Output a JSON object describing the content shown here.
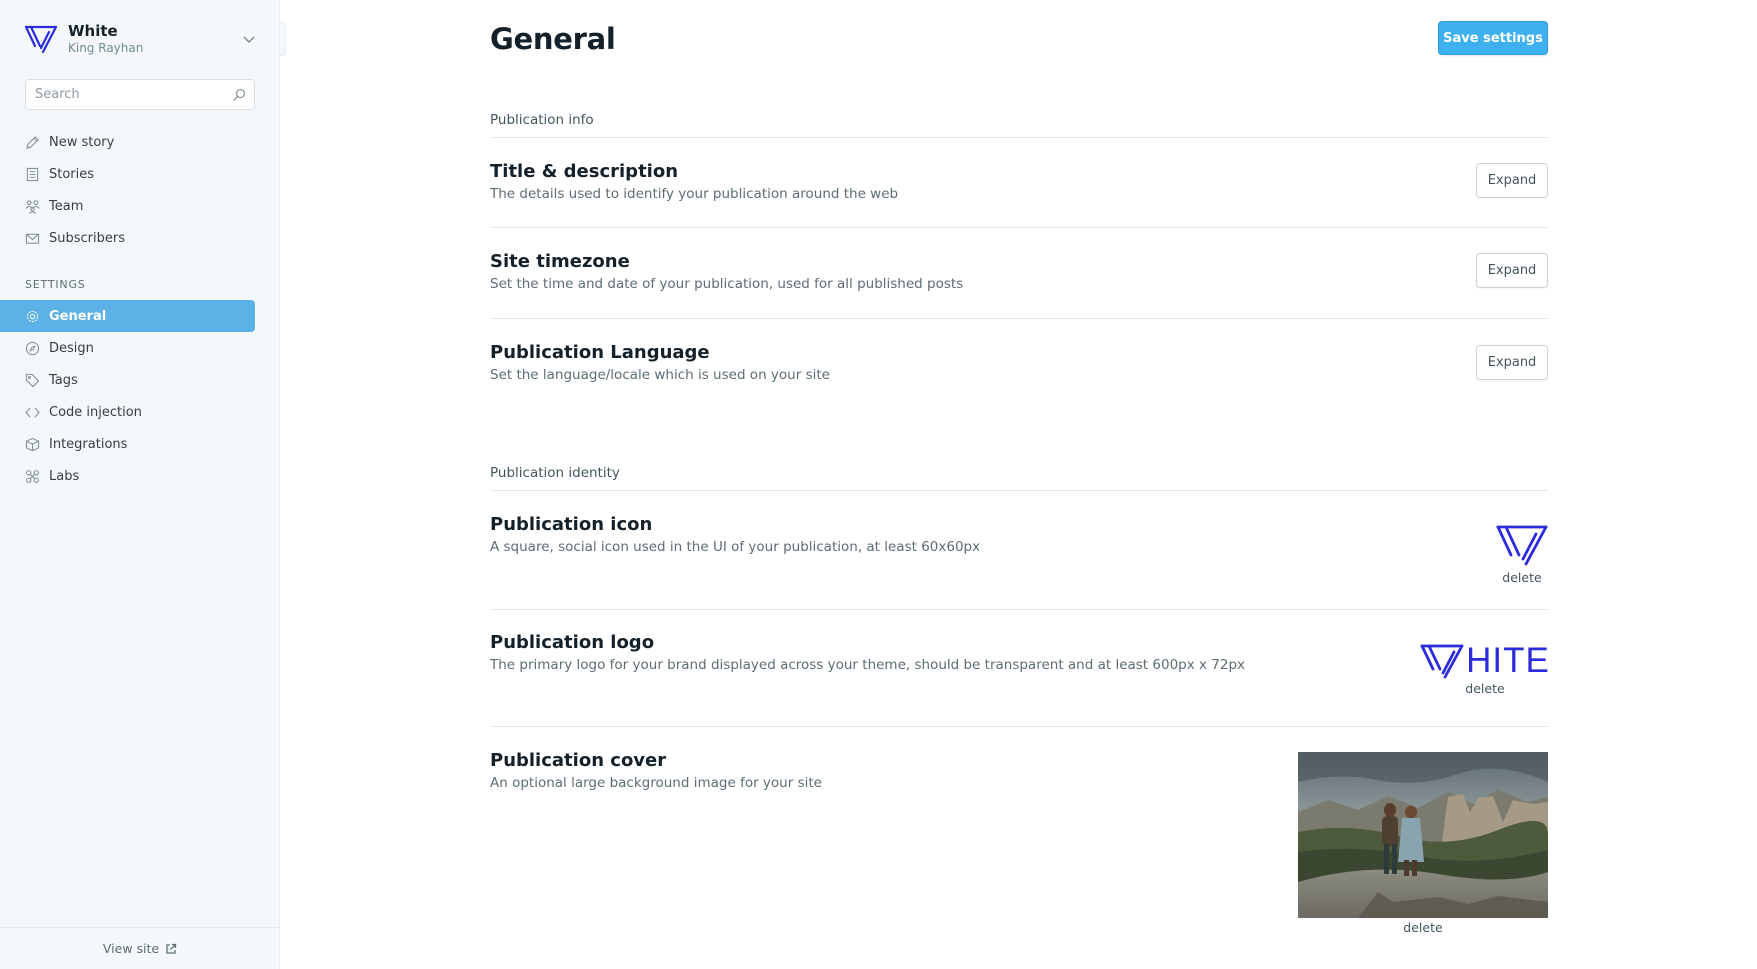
{
  "brand": {
    "title": "White",
    "subtitle": "King Rayhan",
    "accent": "#2b2bdc"
  },
  "search": {
    "placeholder": "Search"
  },
  "nav": {
    "main": [
      {
        "label": "New story",
        "icon": "pencil-icon"
      },
      {
        "label": "Stories",
        "icon": "document-icon"
      },
      {
        "label": "Team",
        "icon": "team-icon"
      },
      {
        "label": "Subscribers",
        "icon": "envelope-icon"
      }
    ],
    "settings_label": "SETTINGS",
    "settings": [
      {
        "label": "General",
        "icon": "gear-icon",
        "active": true
      },
      {
        "label": "Design",
        "icon": "compass-icon"
      },
      {
        "label": "Tags",
        "icon": "tag-icon"
      },
      {
        "label": "Code injection",
        "icon": "code-icon"
      },
      {
        "label": "Integrations",
        "icon": "box-icon"
      },
      {
        "label": "Labs",
        "icon": "labs-icon"
      }
    ]
  },
  "footer": {
    "view_site": "View site"
  },
  "page": {
    "title": "General",
    "save_label": "Save settings",
    "publication_info": {
      "heading": "Publication info",
      "items": [
        {
          "title": "Title & description",
          "desc": "The details used to identify your publication around the web",
          "action": "Expand"
        },
        {
          "title": "Site timezone",
          "desc": "Set the time and date of your publication, used for all published posts",
          "action": "Expand"
        },
        {
          "title": "Publication Language",
          "desc": "Set the language/locale which is used on your site",
          "action": "Expand"
        }
      ]
    },
    "publication_identity": {
      "heading": "Publication identity",
      "icon": {
        "title": "Publication icon",
        "desc": "A square, social icon used in the UI of your publication, at least 60x60px",
        "delete": "delete"
      },
      "logo": {
        "title": "Publication logo",
        "desc": "The primary logo for your brand displayed across your theme, should be transparent and at least 600px x 72px",
        "delete": "delete",
        "logo_text": "HITE"
      },
      "cover": {
        "title": "Publication cover",
        "desc": "An optional large background image for your site",
        "delete": "delete"
      }
    }
  },
  "colors": {
    "accent": "#3eb0ef",
    "active_nav": "#5cb1e6",
    "sidebar_bg": "#f4f8fb"
  }
}
